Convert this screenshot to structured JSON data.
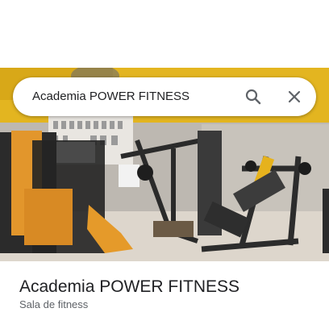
{
  "search": {
    "query": "Academia POWER FITNESS"
  },
  "icons": {
    "search": "search-icon",
    "close": "close-icon"
  },
  "place": {
    "name": "Academia POWER FITNESS",
    "category": "Sala de fitness"
  },
  "colors": {
    "wall_yellow": "#e6b81e",
    "machine_orange": "#e2962c",
    "text_primary": "#202124",
    "text_secondary": "#5f6368"
  }
}
